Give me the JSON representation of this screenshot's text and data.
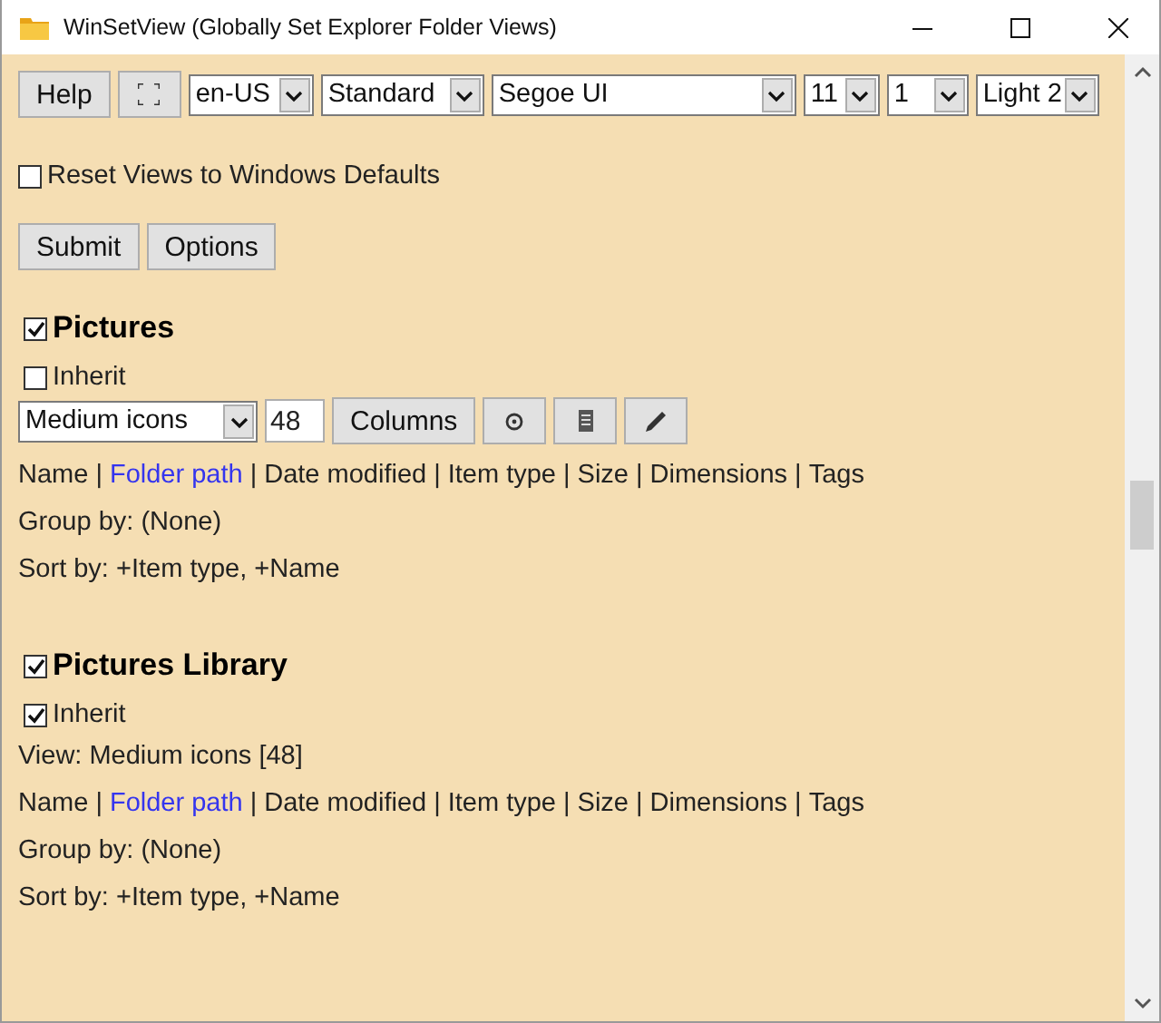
{
  "window": {
    "title": "WinSetView (Globally Set Explorer Folder Views)"
  },
  "toolbar": {
    "help_button": "Help",
    "selects": [
      {
        "value": "en-US"
      },
      {
        "value": "Standard"
      },
      {
        "value": "Segoe UI"
      },
      {
        "value": "11"
      },
      {
        "value": "1"
      },
      {
        "value": "Light 2"
      }
    ]
  },
  "reset": {
    "label": "Reset Views to Windows Defaults",
    "checked": false
  },
  "buttons": [
    "Submit",
    "Options"
  ],
  "sections": [
    {
      "kind": "editable",
      "title": "Pictures",
      "checked": true,
      "inherit": {
        "label": "Inherit",
        "checked": false
      },
      "view_select": "Medium icons",
      "icon_size": "48",
      "columns_button": "Columns",
      "columns": [
        {
          "kind": "column",
          "text": "Name",
          "highlighted": false
        },
        {
          "kind": "separator",
          "text": "|"
        },
        {
          "kind": "column",
          "text": "Folder path",
          "highlighted": true
        },
        {
          "kind": "separator",
          "text": "|"
        },
        {
          "kind": "column",
          "text": "Date modified",
          "highlighted": false
        },
        {
          "kind": "separator",
          "text": "|"
        },
        {
          "kind": "column",
          "text": "Item type",
          "highlighted": false
        },
        {
          "kind": "separator",
          "text": "|"
        },
        {
          "kind": "column",
          "text": "Size",
          "highlighted": false
        },
        {
          "kind": "separator",
          "text": "|"
        },
        {
          "kind": "column",
          "text": "Dimensions",
          "highlighted": false
        },
        {
          "kind": "separator",
          "text": "|"
        },
        {
          "kind": "column",
          "text": "Tags",
          "highlighted": false
        }
      ],
      "group_by": "Group by: (None)",
      "sort_by": "Sort by: +Item type, +Name"
    },
    {
      "kind": "inherited",
      "title": "Pictures Library",
      "checked": true,
      "inherit": {
        "label": "Inherit",
        "checked": true
      },
      "view": "View: Medium icons [48]",
      "columns": [
        {
          "kind": "column",
          "text": "Name",
          "highlighted": false
        },
        {
          "kind": "separator",
          "text": "|"
        },
        {
          "kind": "column",
          "text": "Folder path",
          "highlighted": true
        },
        {
          "kind": "separator",
          "text": "|"
        },
        {
          "kind": "column",
          "text": "Date modified",
          "highlighted": false
        },
        {
          "kind": "separator",
          "text": "|"
        },
        {
          "kind": "column",
          "text": "Item type",
          "highlighted": false
        },
        {
          "kind": "separator",
          "text": "|"
        },
        {
          "kind": "column",
          "text": "Size",
          "highlighted": false
        },
        {
          "kind": "separator",
          "text": "|"
        },
        {
          "kind": "column",
          "text": "Dimensions",
          "highlighted": false
        },
        {
          "kind": "separator",
          "text": "|"
        },
        {
          "kind": "column",
          "text": "Tags",
          "highlighted": false
        }
      ],
      "group_by": "Group by: (None)",
      "sort_by": "Sort by: +Item type, +Name"
    }
  ]
}
